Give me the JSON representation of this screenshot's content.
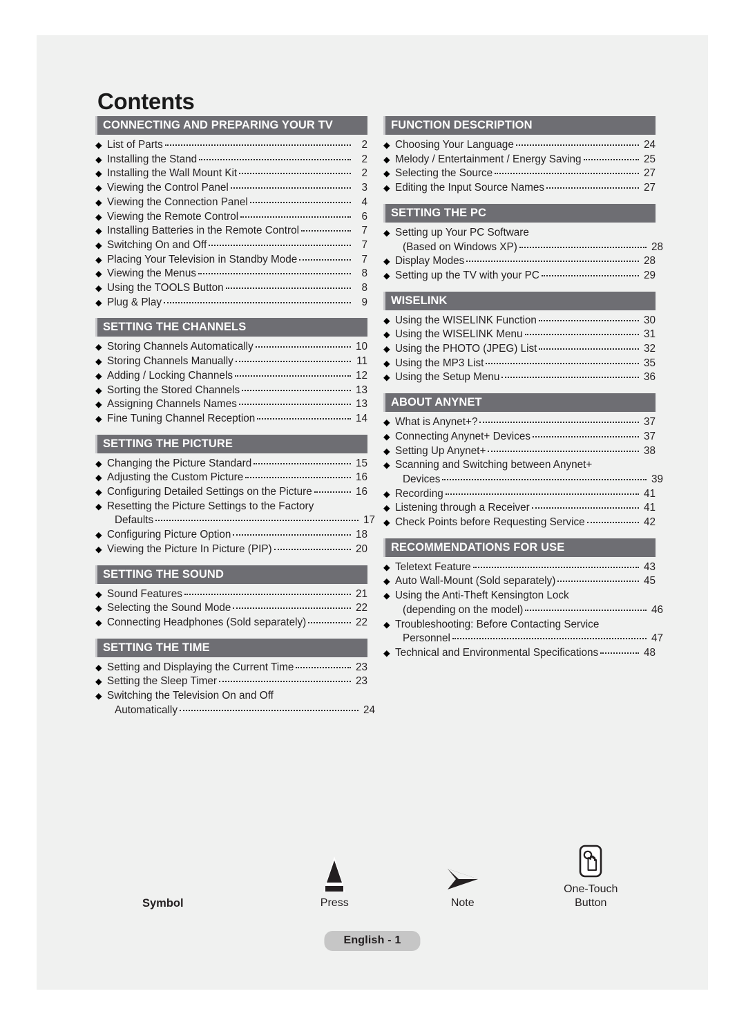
{
  "page": {
    "title": "Contents",
    "footer_badge": "English - 1"
  },
  "left_column": [
    {
      "header": "CONNECTING AND PREPARING YOUR TV",
      "entries": [
        {
          "text": "List of Parts",
          "page": "2"
        },
        {
          "text": "Installing the Stand",
          "page": "2"
        },
        {
          "text": "Installing the Wall Mount Kit",
          "page": "2"
        },
        {
          "text": "Viewing the Control Panel",
          "page": "3"
        },
        {
          "text": "Viewing the Connection Panel",
          "page": "4"
        },
        {
          "text": "Viewing the Remote Control",
          "page": "6"
        },
        {
          "text": "Installing Batteries in the Remote Control",
          "page": "7"
        },
        {
          "text": "Switching On and Off",
          "page": "7"
        },
        {
          "text": "Placing Your Television in Standby Mode",
          "page": "7"
        },
        {
          "text": "Viewing the Menus",
          "page": "8"
        },
        {
          "text": "Using the TOOLS Button",
          "page": "8"
        },
        {
          "text": "Plug & Play",
          "page": "9"
        }
      ]
    },
    {
      "header": "SETTING THE CHANNELS",
      "entries": [
        {
          "text": "Storing Channels Automatically",
          "page": "10"
        },
        {
          "text": "Storing Channels Manually",
          "page": "11"
        },
        {
          "text": "Adding / Locking Channels",
          "page": "12"
        },
        {
          "text": "Sorting the Stored Channels",
          "page": "13"
        },
        {
          "text": "Assigning Channels Names",
          "page": "13"
        },
        {
          "text": "Fine Tuning Channel Reception",
          "page": "14"
        }
      ]
    },
    {
      "header": "SETTING THE PICTURE",
      "entries": [
        {
          "text": "Changing the Picture Standard",
          "page": "15"
        },
        {
          "text": "Adjusting the Custom Picture",
          "page": "16"
        },
        {
          "text": "Configuring Detailed Settings on the Picture",
          "page": "16"
        },
        {
          "text": "Resetting the Picture Settings to the Factory",
          "text2": "Defaults",
          "page": "17"
        },
        {
          "text": "Configuring Picture Option",
          "page": "18"
        },
        {
          "text": "Viewing the Picture In Picture (PIP)",
          "page": "20"
        }
      ]
    },
    {
      "header": "SETTING THE SOUND",
      "entries": [
        {
          "text": "Sound Features",
          "page": "21"
        },
        {
          "text": "Selecting the Sound Mode",
          "page": "22"
        },
        {
          "text": "Connecting Headphones (Sold separately)",
          "page": "22"
        }
      ]
    },
    {
      "header": "SETTING THE TIME",
      "entries": [
        {
          "text": "Setting and Displaying the Current Time",
          "page": "23"
        },
        {
          "text": "Setting the Sleep Timer",
          "page": "23"
        },
        {
          "text": "Switching the Television On and Off",
          "text2": "Automatically",
          "page": "24"
        }
      ]
    }
  ],
  "right_column": [
    {
      "header": "FUNCTION DESCRIPTION",
      "entries": [
        {
          "text": "Choosing Your Language",
          "page": "24"
        },
        {
          "text": "Melody / Entertainment / Energy Saving",
          "page": "25"
        },
        {
          "text": "Selecting the Source",
          "page": "27"
        },
        {
          "text": "Editing the Input Source Names",
          "page": "27"
        }
      ]
    },
    {
      "header": "SETTING THE PC",
      "entries": [
        {
          "text": "Setting up Your PC Software",
          "text2": "(Based on Windows XP)",
          "page": "28"
        },
        {
          "text": "Display Modes",
          "page": "28"
        },
        {
          "text": "Setting up the TV with your PC",
          "page": "29"
        }
      ]
    },
    {
      "header": "WISELINK",
      "entries": [
        {
          "text": "Using the WISELINK Function",
          "page": "30"
        },
        {
          "text": "Using the WISELINK Menu",
          "page": "31"
        },
        {
          "text": "Using the PHOTO (JPEG) List",
          "page": "32"
        },
        {
          "text": "Using the MP3 List",
          "page": "35"
        },
        {
          "text": "Using the Setup Menu",
          "page": "36"
        }
      ]
    },
    {
      "header": "ABOUT ANYNET",
      "header_sup": "+",
      "entries": [
        {
          "text": "What is Anynet+?",
          "page": "37"
        },
        {
          "text": "Connecting Anynet+ Devices",
          "page": "37"
        },
        {
          "text": "Setting Up Anynet+",
          "page": "38"
        },
        {
          "text": "Scanning and Switching between Anynet+",
          "text2": "Devices",
          "page": "39"
        },
        {
          "text": "Recording",
          "page": "41"
        },
        {
          "text": "Listening through a Receiver",
          "page": "41"
        },
        {
          "text": "Check Points before Requesting Service",
          "page": "42"
        }
      ]
    },
    {
      "header": "RECOMMENDATIONS FOR USE",
      "entries": [
        {
          "text": "Teletext Feature",
          "page": "43"
        },
        {
          "text": "Auto Wall-Mount (Sold separately)",
          "page": "45"
        },
        {
          "text": "Using the Anti-Theft Kensington Lock",
          "text2": "(depending on the model)",
          "page": "46"
        },
        {
          "text": "Troubleshooting: Before Contacting Service",
          "text2": "Personnel",
          "page": "47"
        },
        {
          "text": "Technical and Environmental Specifications",
          "page": "48"
        }
      ]
    }
  ],
  "legend": {
    "title": "Symbol",
    "items": [
      {
        "label": "Press",
        "icon": "press-triangle-icon"
      },
      {
        "label": "Note",
        "icon": "note-arrow-icon"
      },
      {
        "label": "One-Touch",
        "label2": "Button",
        "icon": "one-touch-button-icon"
      }
    ]
  },
  "colors": {
    "page_background": "#f0f1f0",
    "section_header_bar": "#6e6e73",
    "section_header_text": "#ffffff",
    "body_text": "#231f20",
    "badge_background": "#c6c6c6"
  }
}
